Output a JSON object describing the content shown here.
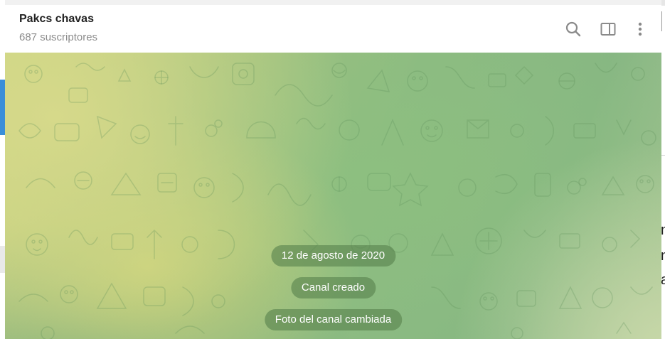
{
  "chat": {
    "title": "Pakcs chavas",
    "subtitle": "687 suscriptores"
  },
  "header_icons": [
    "search-icon",
    "sidebar-toggle-icon",
    "more-vertical-icon"
  ],
  "messages": {
    "date": "12 de agosto de 2020",
    "created": "Canal creado",
    "photo_changed": "Foto del canal cambiada"
  },
  "background_right": {
    "chars": [
      "n",
      "n",
      "a"
    ]
  },
  "colors": {
    "accent": "#3a8fd9",
    "title": "#222222",
    "subtitle": "#8c8c8c",
    "icon": "#8a8a8a"
  }
}
